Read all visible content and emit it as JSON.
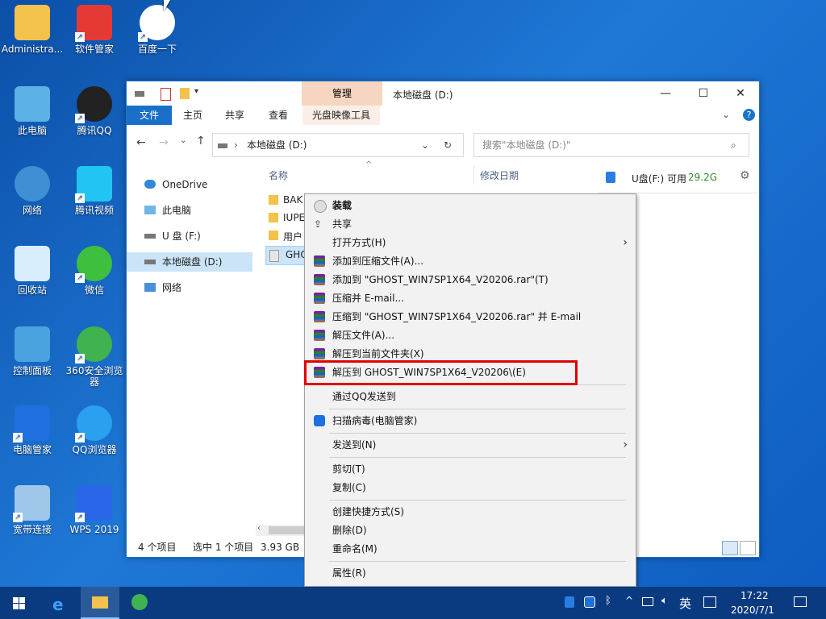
{
  "desktop": {
    "icons": [
      {
        "label": "Administra..."
      },
      {
        "label": "软件管家"
      },
      {
        "label": "百度一下"
      },
      {
        "label": "此电脑"
      },
      {
        "label": "腾讯QQ"
      },
      {
        "label": "网络"
      },
      {
        "label": "腾讯视频"
      },
      {
        "label": "回收站"
      },
      {
        "label": "微信"
      },
      {
        "label": "控制面板"
      },
      {
        "label": "360安全浏览器"
      },
      {
        "label": "电脑管家"
      },
      {
        "label": "QQ浏览器"
      },
      {
        "label": "宽带连接"
      },
      {
        "label": "WPS 2019"
      }
    ]
  },
  "window": {
    "title": "本地磁盘 (D:)",
    "manage_tab": "管理",
    "ribbon_tabs": [
      "文件",
      "主页",
      "共享",
      "查看",
      "光盘映像工具"
    ],
    "address_path": "本地磁盘 (D:)",
    "search_placeholder": "搜索\"本地磁盘 (D:)\"",
    "col_name": "名称",
    "col_date": "修改日期",
    "nav": [
      "OneDrive",
      "此电脑",
      "U 盘 (F:)",
      "本地磁盘 (D:)",
      "网络"
    ],
    "files": [
      "BAK",
      "IUPE",
      "用户",
      "GHO"
    ],
    "drive_info_label": "U盘(F:) 可用",
    "drive_info_free": "29.2G",
    "status_count": "4 个项目",
    "status_selected": "选中 1 个项目",
    "status_size": "3.93 GB"
  },
  "context_menu": {
    "items": [
      {
        "label": "装载",
        "bold": true
      },
      {
        "label": "共享"
      },
      {
        "label": "打开方式(H)"
      },
      {
        "label": "添加到压缩文件(A)..."
      },
      {
        "label": "添加到 \"GHOST_WIN7SP1X64_V20206.rar\"(T)"
      },
      {
        "label": "压缩并 E-mail..."
      },
      {
        "label": "压缩到 \"GHOST_WIN7SP1X64_V20206.rar\" 并 E-mail"
      },
      {
        "label": "解压文件(A)..."
      },
      {
        "label": "解压到当前文件夹(X)"
      },
      {
        "label": "解压到 GHOST_WIN7SP1X64_V20206\\(E)"
      },
      {
        "label": "通过QQ发送到"
      },
      {
        "label": "扫描病毒(电脑管家)"
      },
      {
        "label": "发送到(N)"
      },
      {
        "label": "剪切(T)"
      },
      {
        "label": "复制(C)"
      },
      {
        "label": "创建快捷方式(S)"
      },
      {
        "label": "删除(D)"
      },
      {
        "label": "重命名(M)"
      },
      {
        "label": "属性(R)"
      }
    ]
  },
  "taskbar": {
    "ime": "英",
    "time": "17:22",
    "date": "2020/7/1"
  }
}
